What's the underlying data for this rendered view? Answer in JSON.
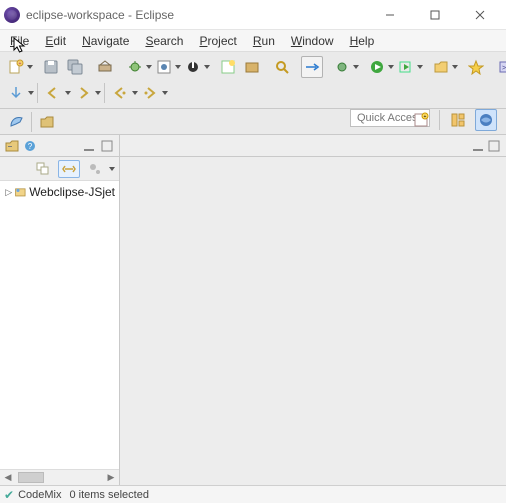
{
  "window": {
    "title": "eclipse-workspace - Eclipse"
  },
  "menu": {
    "file": {
      "label": "File",
      "mn": "F",
      "rest": "ile"
    },
    "edit": {
      "label": "Edit",
      "mn": "E",
      "rest": "dit"
    },
    "navigate": {
      "label": "Navigate",
      "mn": "N",
      "rest": "avigate"
    },
    "search": {
      "label": "Search",
      "mn": "S",
      "rest": "earch"
    },
    "project": {
      "label": "Project",
      "mn": "P",
      "rest": "roject"
    },
    "run": {
      "label": "Run",
      "mn": "R",
      "rest": "un"
    },
    "window": {
      "label": "Window",
      "mn": "W",
      "rest": "indow"
    },
    "help": {
      "label": "Help",
      "mn": "H",
      "rest": "elp"
    }
  },
  "quick_access": {
    "placeholder": "Quick Access"
  },
  "explorer": {
    "items": [
      {
        "label": "Webclipse-JSjet"
      }
    ]
  },
  "status": {
    "brand": "CodeMix",
    "text": "0 items selected"
  }
}
